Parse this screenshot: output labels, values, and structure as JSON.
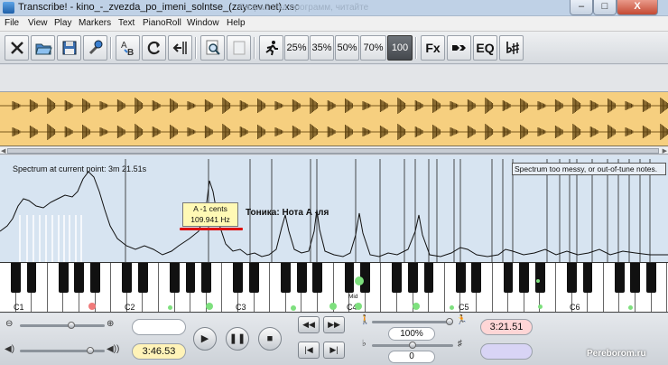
{
  "window": {
    "title": "Transcribe! - kino_-_zvezda_po_imeni_solntse_(zaycev.net).xsc",
    "background_ghost_text": "Разработка программ, читайте",
    "controls": {
      "minimize": "–",
      "maximize": "□",
      "close": "X"
    }
  },
  "menu": [
    "File",
    "View",
    "Play",
    "Markers",
    "Text",
    "PianoRoll",
    "Window",
    "Help"
  ],
  "toolbar": {
    "buttons": [
      {
        "icon": "close-x-icon"
      },
      {
        "icon": "open-folder-icon"
      },
      {
        "icon": "save-disk-icon"
      },
      {
        "icon": "wrench-icon"
      },
      {
        "icon": "text-ab-icon"
      },
      {
        "icon": "loop-icon"
      },
      {
        "icon": "markers-icon"
      },
      {
        "icon": "zoom-icon"
      },
      {
        "icon": "blank-page-icon"
      },
      {
        "icon": "running-man-icon"
      }
    ],
    "speeds": [
      "25%",
      "35%",
      "50%",
      "70%",
      "100"
    ],
    "active_speed": "100",
    "fx_label": "Fx",
    "eq_label": "EQ",
    "arrow_icon": "arrow-right-icon",
    "pitch_icon": "flat-sharp-icon"
  },
  "spectrum": {
    "label": "Spectrum at current point: 3m 21.51s",
    "warning": "Spectrum too messy, or out-of-tune notes.",
    "tooltip": {
      "note": "A -1 cents",
      "freq": "109.941 Hz"
    },
    "annotation": "Тоника: Нота А -ля",
    "colors": {
      "background": "#d7e4f1",
      "line": "#111111",
      "highlight": "#d11111"
    }
  },
  "piano": {
    "octave_labels": [
      "C1",
      "C2",
      "C3",
      "C4",
      "C5",
      "C6"
    ],
    "mid_label": "Mid",
    "dot_colors": {
      "green": "#7ee07e",
      "red": "#f07a7a"
    }
  },
  "controls": {
    "position_time": "3:46.53",
    "current_time": "3:21.51",
    "speed_value": "100%",
    "pitch_value": "0",
    "buttons": {
      "rewind": "◀◀",
      "forward": "▶▶",
      "play": "▶",
      "pause": "❚❚",
      "stop": "■",
      "prev": "|◀",
      "next": "▶|"
    }
  },
  "watermark": "Pereborom.ru"
}
